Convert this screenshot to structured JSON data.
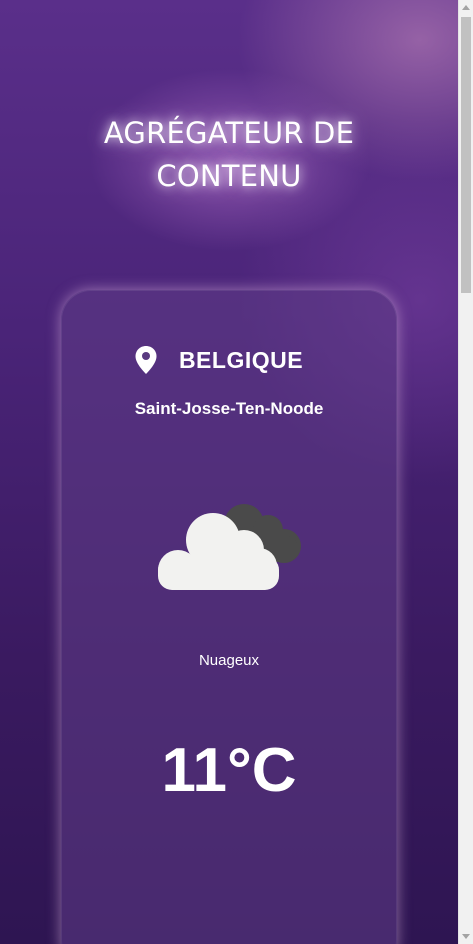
{
  "header": {
    "title_line1": "AGRÉGATEUR DE",
    "title_line2": "CONTENU"
  },
  "weather": {
    "location_icon": "map-pin-icon",
    "country": "BELGIQUE",
    "city": "Saint-Josse-Ten-Noode",
    "condition_icon": "cloudy-icon",
    "condition": "Nuageux",
    "temperature": "11°C"
  },
  "colors": {
    "background_top": "#5a2f8a",
    "background_bottom": "#2e1552",
    "card": "#5f3c87",
    "text": "#ffffff"
  }
}
